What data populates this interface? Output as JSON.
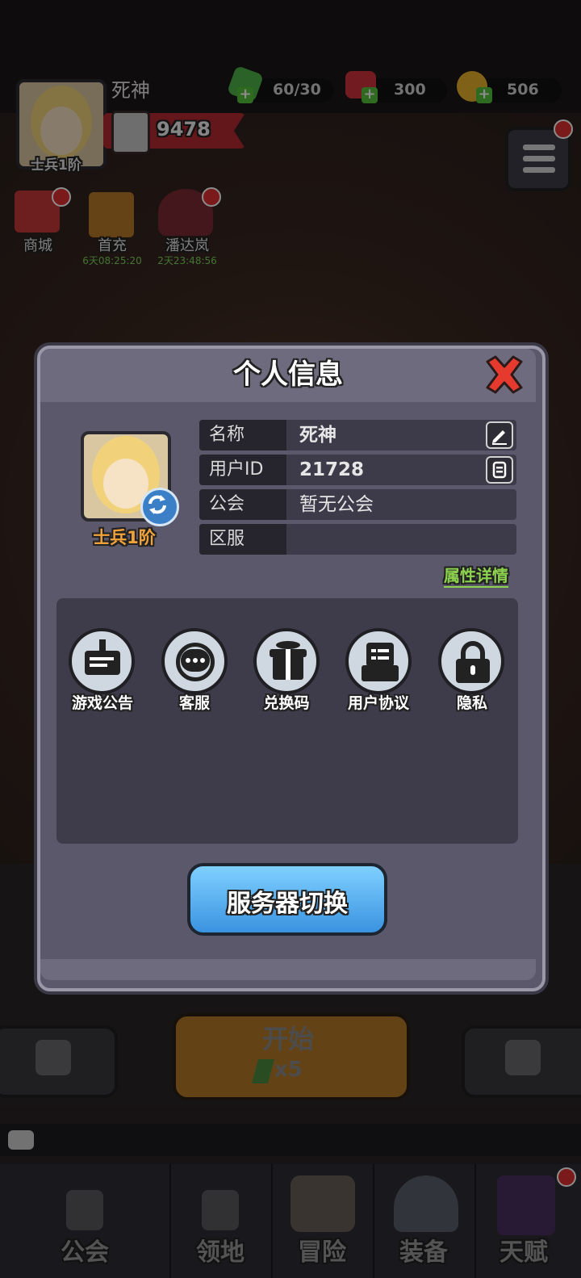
{
  "hud": {
    "player_name": "死神",
    "rank": "士兵1阶",
    "power": "9478",
    "energy": "60/30",
    "gems": "300",
    "coins": "506",
    "shortcuts": [
      {
        "label": "商城",
        "timer": ""
      },
      {
        "label": "首充",
        "timer": "6天08:25:20"
      },
      {
        "label": "潘达岚",
        "timer": "2天23:48:56"
      }
    ]
  },
  "modal": {
    "title": "个人信息",
    "rank": "士兵1阶",
    "rows": [
      {
        "key": "名称",
        "value": "死神"
      },
      {
        "key": "用户ID",
        "value": "21728"
      },
      {
        "key": "公会",
        "value": "暂无公会"
      },
      {
        "key": "区服",
        "value": ""
      }
    ],
    "attr_link": "属性详情",
    "functions": [
      {
        "label": "游戏公告",
        "icon": "notice-board-icon"
      },
      {
        "label": "客服",
        "icon": "headset-chat-icon"
      },
      {
        "label": "兑换码",
        "icon": "gift-icon"
      },
      {
        "label": "用户协议",
        "icon": "agreement-icon"
      },
      {
        "label": "隐私",
        "icon": "lock-icon"
      }
    ],
    "server_button": "服务器切换"
  },
  "bottom": {
    "start_label": "开始",
    "start_cost": "x5",
    "tabs": [
      "公会",
      "领地",
      "冒险",
      "装备",
      "天赋"
    ]
  }
}
